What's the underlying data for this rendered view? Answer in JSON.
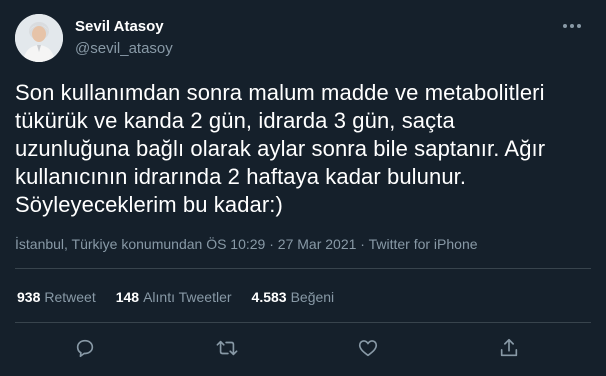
{
  "author": {
    "name": "Sevil Atasoy",
    "handle": "@sevil_atasoy",
    "avatar_icon": "profile-photo"
  },
  "tweet": {
    "text": "Son kullanımdan sonra malum madde ve metabolitleri\ntükürük ve kanda 2 gün, idrarda 3 gün, saçta\nuzunluğuna bağlı olarak aylar sonra bile saptanır. Ağır\nkullanıcının idrarında 2 haftaya kadar bulunur.\nSöyleyeceklerim bu kadar:)",
    "meta": "İstanbul, Türkiye konumundan ÖS 10:29 · 27 Mar 2021 · Twitter for iPhone"
  },
  "stats": {
    "retweets": {
      "value": "938",
      "label": "Retweet"
    },
    "quotes": {
      "value": "148",
      "label": "Alıntı Tweetler"
    },
    "likes": {
      "value": "4.583",
      "label": "Beğeni"
    }
  },
  "actions": [
    "reply-icon",
    "retweet-icon",
    "like-icon",
    "share-icon"
  ],
  "colors": {
    "background": "#15202b",
    "text": "#ffffff",
    "secondary_text": "#8899a6",
    "divider": "#38444d"
  }
}
